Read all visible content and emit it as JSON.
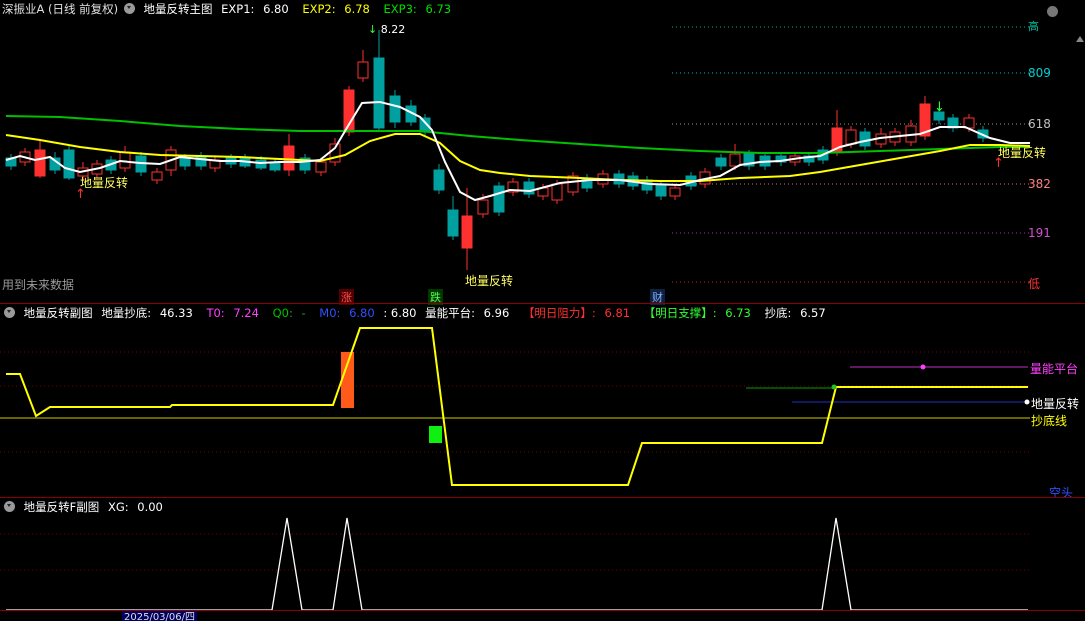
{
  "main": {
    "title_prefix": "深振业A (日线 前复权)",
    "indicator_name": "地量反转主图",
    "exp1_label": "EXP1:",
    "exp1_value": "6.80",
    "exp2_label": "EXP2:",
    "exp2_value": "6.78",
    "exp3_label": "EXP3:",
    "exp3_value": "6.73",
    "price_marker": "8.22",
    "future_data_note": "用到未来数据",
    "signal_label": "地量反转",
    "levels": [
      {
        "label": "高",
        "color": "#00d0b0"
      },
      {
        "label": "809",
        "color": "#00d0d0"
      },
      {
        "label": "618",
        "color": "#c0c0c0"
      },
      {
        "label": "382",
        "color": "#ff7f7f"
      },
      {
        "label": "191",
        "color": "#c040c0"
      },
      {
        "label": "低",
        "color": "#ff3030"
      }
    ],
    "markers": [
      {
        "label": "涨",
        "color": "#ff4040",
        "bg": "#5a0000"
      },
      {
        "label": "跌",
        "color": "#40ff40",
        "bg": "#004000"
      },
      {
        "label": "财",
        "color": "#60a0ff",
        "bg": "#001a40"
      }
    ]
  },
  "sub1": {
    "indicator_name": "地量反转副图",
    "dlcd_label": "地量抄底:",
    "dlcd_value": "46.33",
    "t0_label": "T0:",
    "t0_value": "7.24",
    "q0_label": "Q0:",
    "q0_value": "-",
    "m0_label": "M0:",
    "m0_value": "6.80",
    "extra_value": ": 6.80",
    "lnpt_label": "量能平台:",
    "lnpt_value": "6.96",
    "zl_label": "【明日阻力】:",
    "zl_value": "6.81",
    "zc_label": "【明日支撑】:",
    "zc_value": "6.73",
    "cd_label": "抄底:",
    "cd_value": "6.57",
    "right_labels": [
      "量能平台",
      "地量反转",
      "抄底线",
      "空头"
    ]
  },
  "sub2": {
    "indicator_name": "地量反转F副图",
    "xg_label": "XG:",
    "xg_value": "0.00"
  },
  "date_bar": {
    "date_text": "2025/03/06/四"
  },
  "colors": {
    "up": "#ff3030",
    "down": "#00a0a0",
    "ma_white": "#ffffff",
    "ma_yellow": "#ffff00",
    "ma_green": "#00c000"
  }
}
